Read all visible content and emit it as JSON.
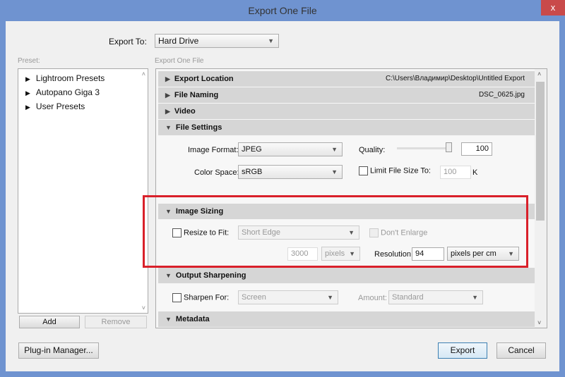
{
  "window": {
    "title": "Export One File",
    "close": "x"
  },
  "export_to": {
    "label": "Export To:",
    "value": "Hard Drive"
  },
  "preset": {
    "label": "Preset:",
    "items": [
      "Lightroom Presets",
      "Autopano Giga 3",
      "User Presets"
    ],
    "add": "Add",
    "remove": "Remove"
  },
  "panel_title": "Export One File",
  "sections": {
    "export_location": {
      "title": "Export Location",
      "value": "C:\\Users\\Владимир\\Desktop\\Untitled Export"
    },
    "file_naming": {
      "title": "File Naming",
      "value": "DSC_0625.jpg"
    },
    "video": {
      "title": "Video"
    },
    "file_settings": {
      "title": "File Settings",
      "image_format_label": "Image Format:",
      "image_format": "JPEG",
      "quality_label": "Quality:",
      "quality": "100",
      "quality_fraction": 1.0,
      "color_space_label": "Color Space:",
      "color_space": "sRGB",
      "limit_label": "Limit File Size To:",
      "limit_value": "100",
      "limit_unit": "K"
    },
    "image_sizing": {
      "title": "Image Sizing",
      "resize_label": "Resize to Fit:",
      "resize_mode": "Short Edge",
      "dont_enlarge": "Don't Enlarge",
      "size": "3000",
      "size_unit": "pixels",
      "resolution_label": "Resolution:",
      "resolution": "94",
      "resolution_unit": "pixels per cm"
    },
    "output_sharpening": {
      "title": "Output Sharpening",
      "sharpen_label": "Sharpen For:",
      "sharpen_for": "Screen",
      "amount_label": "Amount:",
      "amount": "Standard"
    },
    "metadata": {
      "title": "Metadata"
    }
  },
  "buttons": {
    "plugin": "Plug-in Manager...",
    "export": "Export",
    "cancel": "Cancel"
  },
  "highlight_color": "#d9202a"
}
